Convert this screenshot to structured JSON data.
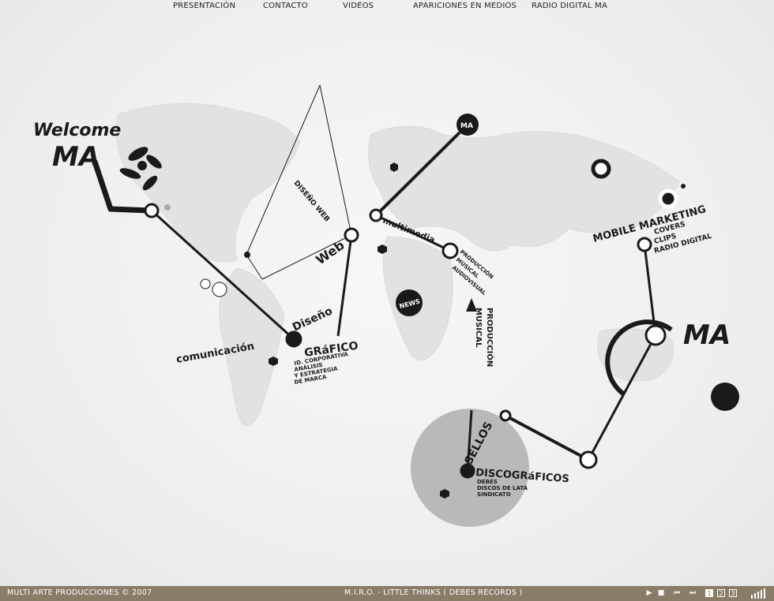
{
  "nav": [
    {
      "label": "PRESENTACIÓN"
    },
    {
      "label": "CONTACTO"
    },
    {
      "label": "VIDEOS"
    },
    {
      "label": "APARICIONES EN MEDIOS"
    },
    {
      "label": "RADIO DIGITAL MA"
    }
  ],
  "brand": {
    "welcome": "Welcome",
    "logo": "MA",
    "badge": "MA",
    "news": "NEWS",
    "web": "Web"
  },
  "nodes": {
    "comunicacion": "comunicación",
    "diseno": "Diseño",
    "grafico": "GRáFICO",
    "grafico_sub": [
      "ID. CORPORATIVA",
      "ANÁLISIS",
      "Y ESTRATEGIA",
      "DE MARCA"
    ],
    "multimedia": "multimedia",
    "web_sub": "DISEÑO WEB",
    "audiovisual_sub": [
      "PRODUCCIÓN",
      "MUSICAL",
      "AUDIOVISUAL"
    ],
    "musical": "MUSICAL",
    "produccion": "PRODUCCIÓN",
    "mobile": "MOBILE MARKETING",
    "mobile_sub": [
      "COVERS",
      "CLIPS",
      "RADIO DIGITAL"
    ],
    "sellos": "SELLOS",
    "discograficos": "DISCOGRáFICOS",
    "discograficos_sub": [
      "DEBES",
      "DISCOS DE LATA",
      "SINDICATO"
    ]
  },
  "footer": {
    "copyright": "MULTI ARTE PRODUCCIONES © 2007",
    "track": "M.I.R.O. - LITTLE THINKS ( DEBES RECORDS )",
    "play": "▶",
    "stop": "■",
    "prev": "⏮",
    "next": "⏭",
    "pages": [
      "1",
      "2",
      "3"
    ],
    "active_page": "1",
    "volume_levels": [
      0.4,
      0.55,
      0.7,
      0.85,
      1.0
    ]
  },
  "colors": {
    "footer_bg": "#8a7d68",
    "ink": "#1a1a1a",
    "highlight_circle": "#b9b9b9"
  }
}
